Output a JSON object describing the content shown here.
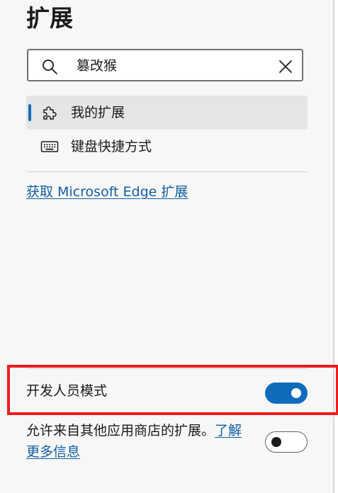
{
  "page": {
    "title": "扩展"
  },
  "search": {
    "value": "篡改猴",
    "icon": "search-icon",
    "clear_icon": "close-icon"
  },
  "nav": {
    "items": [
      {
        "label": "我的扩展",
        "icon": "puzzle-icon",
        "selected": true
      },
      {
        "label": "键盘快捷方式",
        "icon": "keyboard-icon",
        "selected": false
      }
    ]
  },
  "links": {
    "get_extensions": "获取 Microsoft Edge 扩展"
  },
  "settings": {
    "developer_mode": {
      "label": "开发人员模式",
      "enabled": true
    },
    "other_stores": {
      "text": "允许来自其他应用商店的扩展。",
      "link": "了解更多信息",
      "enabled": false
    }
  },
  "colors": {
    "accent": "#0f6cbd",
    "link": "#115ea3",
    "highlight": "#ee1c1c"
  }
}
